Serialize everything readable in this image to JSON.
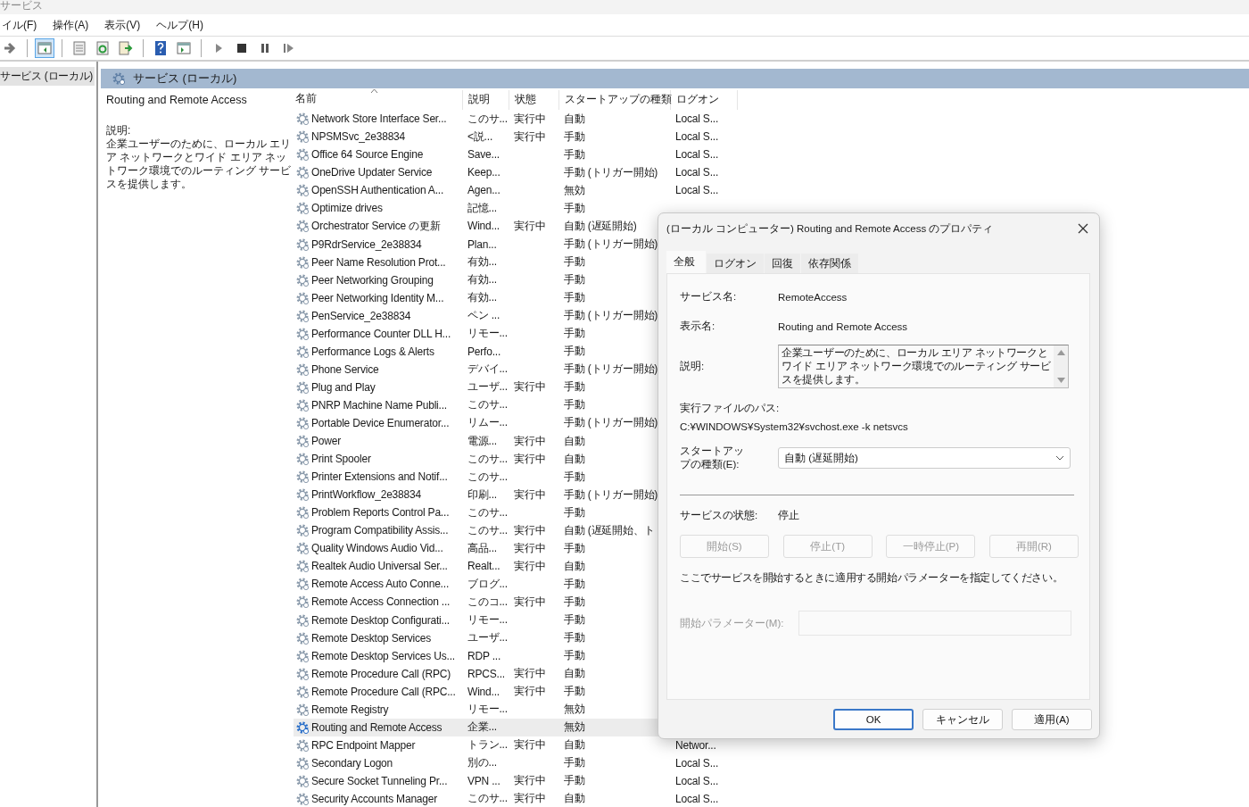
{
  "window": {
    "title": "サービス"
  },
  "menu": [
    "イル(F)",
    "操作(A)",
    "表示(V)",
    "ヘルプ(H)"
  ],
  "toolbar": [
    {
      "kind": "back",
      "selected": false
    },
    {
      "kind": "separator"
    },
    {
      "kind": "tree",
      "selected": true
    },
    {
      "kind": "separator"
    },
    {
      "kind": "properties",
      "selected": false
    },
    {
      "kind": "refresh",
      "selected": false
    },
    {
      "kind": "export",
      "selected": false
    },
    {
      "kind": "separator"
    },
    {
      "kind": "help",
      "selected": false
    },
    {
      "kind": "view",
      "selected": false
    },
    {
      "kind": "separator"
    },
    {
      "kind": "play",
      "selected": false
    },
    {
      "kind": "stop",
      "selected": false
    },
    {
      "kind": "pause",
      "selected": false
    },
    {
      "kind": "resume",
      "selected": false
    }
  ],
  "tree": {
    "items": [
      {
        "label": "サービス (ローカル)",
        "selected": true
      }
    ]
  },
  "pane_header": "サービス (ローカル)",
  "details": {
    "title": "Routing and Remote Access",
    "description_label": "説明:",
    "description": "企業ユーザーのために、ローカル エリア ネットワークとワイド エリア ネットワーク環境でのルーティング サービスを提供します。"
  },
  "table": {
    "columns": [
      {
        "label": "名前",
        "sorted": true
      },
      {
        "label": "説明",
        "sorted": false
      },
      {
        "label": "状態",
        "sorted": false
      },
      {
        "label": "スタートアップの種類",
        "sorted": false
      },
      {
        "label": "ログオン",
        "sorted": false
      }
    ],
    "rows": [
      {
        "name": "Network Store Interface Ser...",
        "description": "このサ...",
        "status": "実行中",
        "startup": "自動",
        "logon": "Local S...",
        "selected": false
      },
      {
        "name": "NPSMSvc_2e38834",
        "description": "<説...",
        "status": "実行中",
        "startup": "手動",
        "logon": "Local S...",
        "selected": false
      },
      {
        "name": "Office 64 Source Engine",
        "description": "Save...",
        "startup": "手動",
        "logon": "Local S...",
        "selected": false
      },
      {
        "name": "OneDrive Updater Service",
        "description": "Keep...",
        "startup": "手動 (トリガー開始)",
        "logon": "Local S...",
        "selected": false
      },
      {
        "name": "OpenSSH Authentication A...",
        "description": "Agen...",
        "startup": "無効",
        "logon": "Local S...",
        "selected": false
      },
      {
        "name": "Optimize drives",
        "description": "記憶...",
        "startup": "手動",
        "selected": false
      },
      {
        "name": "Orchestrator Service の更新",
        "description": "Wind...",
        "status": "実行中",
        "startup": "自動 (遅延開始)",
        "selected": false
      },
      {
        "name": "P9RdrService_2e38834",
        "description": "Plan...",
        "startup": "手動 (トリガー開始)",
        "selected": false
      },
      {
        "name": "Peer Name Resolution Prot...",
        "description": "有効...",
        "startup": "手動",
        "selected": false
      },
      {
        "name": "Peer Networking Grouping",
        "description": "有効...",
        "startup": "手動",
        "selected": false
      },
      {
        "name": "Peer Networking Identity M...",
        "description": "有効...",
        "startup": "手動",
        "selected": false
      },
      {
        "name": "PenService_2e38834",
        "description": "ペン ...",
        "startup": "手動 (トリガー開始)",
        "selected": false
      },
      {
        "name": "Performance Counter DLL H...",
        "description": "リモー...",
        "startup": "手動",
        "selected": false
      },
      {
        "name": "Performance Logs & Alerts",
        "description": "Perfo...",
        "startup": "手動",
        "selected": false
      },
      {
        "name": "Phone Service",
        "description": "デバイ...",
        "startup": "手動 (トリガー開始)",
        "selected": false
      },
      {
        "name": "Plug and Play",
        "description": "ユーザ...",
        "status": "実行中",
        "startup": "手動",
        "selected": false
      },
      {
        "name": "PNRP Machine Name Publi...",
        "description": "このサ...",
        "startup": "手動",
        "selected": false
      },
      {
        "name": "Portable Device Enumerator...",
        "description": "リムー...",
        "startup": "手動 (トリガー開始)",
        "selected": false
      },
      {
        "name": "Power",
        "description": "電源...",
        "status": "実行中",
        "startup": "自動",
        "selected": false
      },
      {
        "name": "Print Spooler",
        "description": "このサ...",
        "status": "実行中",
        "startup": "自動",
        "selected": false
      },
      {
        "name": "Printer Extensions and Notif...",
        "description": "このサ...",
        "startup": "手動",
        "selected": false
      },
      {
        "name": "PrintWorkflow_2e38834",
        "description": "印刷...",
        "status": "実行中",
        "startup": "手動 (トリガー開始)",
        "selected": false
      },
      {
        "name": "Problem Reports Control Pa...",
        "description": "このサ...",
        "startup": "手動",
        "selected": false
      },
      {
        "name": "Program Compatibility Assis...",
        "description": "このサ...",
        "status": "実行中",
        "startup": "自動 (遅延開始、ト",
        "selected": false
      },
      {
        "name": "Quality Windows Audio Vid...",
        "description": "高品...",
        "status": "実行中",
        "startup": "手動",
        "selected": false
      },
      {
        "name": "Realtek Audio Universal Ser...",
        "description": "Realt...",
        "status": "実行中",
        "startup": "自動",
        "selected": false
      },
      {
        "name": "Remote Access Auto Conne...",
        "description": "ブログ...",
        "startup": "手動",
        "selected": false
      },
      {
        "name": "Remote Access Connection ...",
        "description": "このコ...",
        "status": "実行中",
        "startup": "手動",
        "selected": false
      },
      {
        "name": "Remote Desktop Configurati...",
        "description": "リモー...",
        "startup": "手動",
        "selected": false
      },
      {
        "name": "Remote Desktop Services",
        "description": "ユーザ...",
        "startup": "手動",
        "selected": false
      },
      {
        "name": "Remote Desktop Services Us...",
        "description": "RDP ...",
        "startup": "手動",
        "selected": false
      },
      {
        "name": "Remote Procedure Call (RPC)",
        "description": "RPCS...",
        "status": "実行中",
        "startup": "自動",
        "selected": false
      },
      {
        "name": "Remote Procedure Call (RPC...",
        "description": "Wind...",
        "status": "実行中",
        "startup": "手動",
        "selected": false
      },
      {
        "name": "Remote Registry",
        "description": "リモー...",
        "startup": "無効",
        "selected": false
      },
      {
        "name": "Routing and Remote Access",
        "description": "企業...",
        "startup": "無効",
        "selected": true
      },
      {
        "name": "RPC Endpoint Mapper",
        "description": "トラン...",
        "status": "実行中",
        "startup": "自動",
        "logon": "Networ...",
        "selected": false
      },
      {
        "name": "Secondary Logon",
        "description": "別の...",
        "startup": "手動",
        "logon": "Local S...",
        "selected": false
      },
      {
        "name": "Secure Socket Tunneling Pr...",
        "description": "VPN ...",
        "status": "実行中",
        "startup": "手動",
        "logon": "Local S...",
        "selected": false
      },
      {
        "name": "Security Accounts Manager",
        "description": "このサ...",
        "status": "実行中",
        "startup": "自動",
        "logon": "Local S...",
        "selected": false
      }
    ]
  },
  "dialog": {
    "title": "(ローカル コンピューター) Routing and Remote Access のプロパティ",
    "tabs": [
      {
        "label": "全般",
        "selected": true
      },
      {
        "label": "ログオン",
        "selected": false
      },
      {
        "label": "回復",
        "selected": false
      },
      {
        "label": "依存関係",
        "selected": false
      }
    ],
    "service_name": {
      "label": "サービス名:",
      "value": "RemoteAccess"
    },
    "display_name": {
      "label": "表示名:",
      "value": "Routing and Remote Access"
    },
    "description": {
      "label": "説明:",
      "value": "企業ユーザーのために、ローカル エリア ネットワークとワイド エリア ネットワーク環境でのルーティング サービスを提供します。"
    },
    "path": {
      "label": "実行ファイルのパス:",
      "value": "C:¥WINDOWS¥System32¥svchost.exe -k netsvcs"
    },
    "startup": {
      "label": "スタートアップの種類(E):",
      "value": "自動 (遅延開始)"
    },
    "status": {
      "label": "サービスの状態:",
      "value": "停止"
    },
    "service_buttons": [
      {
        "label": "開始(S)",
        "disabled": true
      },
      {
        "label": "停止(T)",
        "disabled": true
      },
      {
        "label": "一時停止(P)",
        "disabled": true
      },
      {
        "label": "再開(R)",
        "disabled": true
      }
    ],
    "hint": "ここでサービスを開始するときに適用する開始パラメーターを指定してください。",
    "parameters": {
      "label": "開始パラメーター(M):",
      "disabled": true
    },
    "buttons": [
      {
        "label": "OK",
        "default": true
      },
      {
        "label": "キャンセル",
        "default": false
      },
      {
        "label": "適用(A)",
        "default": false
      }
    ]
  }
}
